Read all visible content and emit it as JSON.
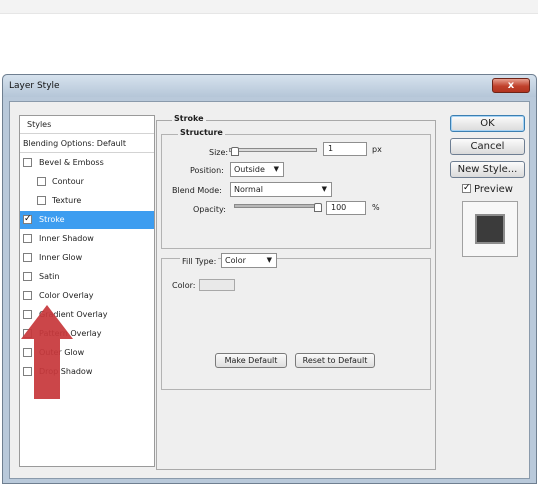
{
  "window": {
    "title": "Layer Style",
    "close_glyph": "x"
  },
  "styles_list": {
    "header": "Styles",
    "items": [
      {
        "label": "Blending Options: Default",
        "checkbox": false,
        "checked": false,
        "selected": false,
        "indent": 0
      },
      {
        "label": "Bevel & Emboss",
        "checkbox": true,
        "checked": false,
        "selected": false,
        "indent": 0
      },
      {
        "label": "Contour",
        "checkbox": true,
        "checked": false,
        "selected": false,
        "indent": 1
      },
      {
        "label": "Texture",
        "checkbox": true,
        "checked": false,
        "selected": false,
        "indent": 1
      },
      {
        "label": "Stroke",
        "checkbox": true,
        "checked": true,
        "selected": true,
        "indent": 0
      },
      {
        "label": "Inner Shadow",
        "checkbox": true,
        "checked": false,
        "selected": false,
        "indent": 0
      },
      {
        "label": "Inner Glow",
        "checkbox": true,
        "checked": false,
        "selected": false,
        "indent": 0
      },
      {
        "label": "Satin",
        "checkbox": true,
        "checked": false,
        "selected": false,
        "indent": 0
      },
      {
        "label": "Color Overlay",
        "checkbox": true,
        "checked": false,
        "selected": false,
        "indent": 0
      },
      {
        "label": "Gradient Overlay",
        "checkbox": true,
        "checked": false,
        "selected": false,
        "indent": 0
      },
      {
        "label": "Pattern Overlay",
        "checkbox": true,
        "checked": false,
        "selected": false,
        "indent": 0
      },
      {
        "label": "Outer Glow",
        "checkbox": true,
        "checked": false,
        "selected": false,
        "indent": 0
      },
      {
        "label": "Drop Shadow",
        "checkbox": true,
        "checked": false,
        "selected": false,
        "indent": 0
      }
    ]
  },
  "stroke": {
    "section_title": "Stroke",
    "structure": {
      "title": "Structure",
      "size_label": "Size:",
      "size_value": "1",
      "size_unit": "px",
      "position_label": "Position:",
      "position_value": "Outside",
      "blend_label": "Blend Mode:",
      "blend_value": "Normal",
      "opacity_label": "Opacity:",
      "opacity_value": "100",
      "opacity_unit": "%"
    },
    "fill": {
      "type_label": "Fill Type:",
      "type_value": "Color",
      "color_label": "Color:"
    },
    "make_default": "Make Default",
    "reset_default": "Reset to Default"
  },
  "buttons": {
    "ok": "OK",
    "cancel": "Cancel",
    "new_style": "New Style..."
  },
  "preview": {
    "label": "Preview",
    "checked": true
  },
  "icons": {
    "dropdown": "chevron-down-icon",
    "check": "checkmark-icon",
    "annotation": "red-up-arrow"
  },
  "colors": {
    "selection": "#3d9df0",
    "arrow": "#c7383b",
    "close": "#c0412c"
  }
}
